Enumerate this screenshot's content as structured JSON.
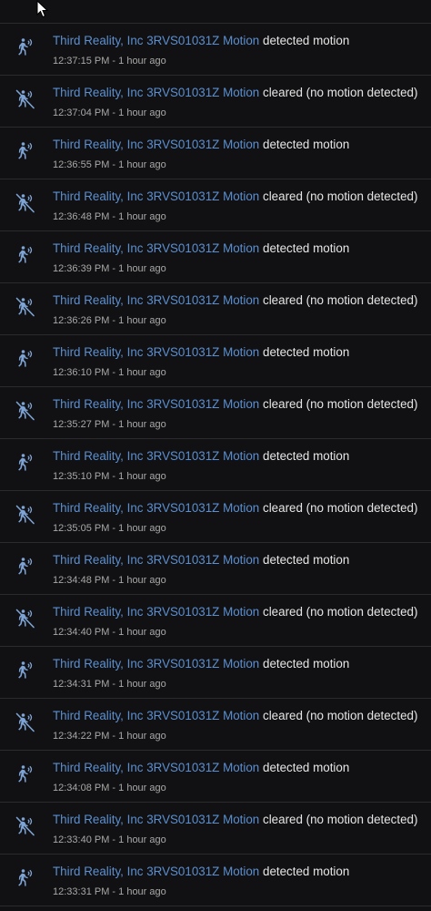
{
  "colors": {
    "background": "#111113",
    "divider": "#2b2b2d",
    "entity_link": "#5b8fd0",
    "icon": "#7ea4d6",
    "text": "#e6e6e6",
    "secondary_text": "#a8a8a8"
  },
  "entries": [
    {
      "entity": "Third Reality, Inc 3RVS01031Z Motion",
      "message": "detected motion",
      "time": "12:37:15 PM - 1 hour ago",
      "icon": "motion-sensor-icon"
    },
    {
      "entity": "Third Reality, Inc 3RVS01031Z Motion",
      "message": "cleared (no motion detected)",
      "time": "12:37:04 PM - 1 hour ago",
      "icon": "motion-sensor-off-icon"
    },
    {
      "entity": "Third Reality, Inc 3RVS01031Z Motion",
      "message": "detected motion",
      "time": "12:36:55 PM - 1 hour ago",
      "icon": "motion-sensor-icon"
    },
    {
      "entity": "Third Reality, Inc 3RVS01031Z Motion",
      "message": "cleared (no motion detected)",
      "time": "12:36:48 PM - 1 hour ago",
      "icon": "motion-sensor-off-icon"
    },
    {
      "entity": "Third Reality, Inc 3RVS01031Z Motion",
      "message": "detected motion",
      "time": "12:36:39 PM - 1 hour ago",
      "icon": "motion-sensor-icon"
    },
    {
      "entity": "Third Reality, Inc 3RVS01031Z Motion",
      "message": "cleared (no motion detected)",
      "time": "12:36:26 PM - 1 hour ago",
      "icon": "motion-sensor-off-icon"
    },
    {
      "entity": "Third Reality, Inc 3RVS01031Z Motion",
      "message": "detected motion",
      "time": "12:36:10 PM - 1 hour ago",
      "icon": "motion-sensor-icon"
    },
    {
      "entity": "Third Reality, Inc 3RVS01031Z Motion",
      "message": "cleared (no motion detected)",
      "time": "12:35:27 PM - 1 hour ago",
      "icon": "motion-sensor-off-icon"
    },
    {
      "entity": "Third Reality, Inc 3RVS01031Z Motion",
      "message": "detected motion",
      "time": "12:35:10 PM - 1 hour ago",
      "icon": "motion-sensor-icon"
    },
    {
      "entity": "Third Reality, Inc 3RVS01031Z Motion",
      "message": "cleared (no motion detected)",
      "time": "12:35:05 PM - 1 hour ago",
      "icon": "motion-sensor-off-icon"
    },
    {
      "entity": "Third Reality, Inc 3RVS01031Z Motion",
      "message": "detected motion",
      "time": "12:34:48 PM - 1 hour ago",
      "icon": "motion-sensor-icon"
    },
    {
      "entity": "Third Reality, Inc 3RVS01031Z Motion",
      "message": "cleared (no motion detected)",
      "time": "12:34:40 PM - 1 hour ago",
      "icon": "motion-sensor-off-icon"
    },
    {
      "entity": "Third Reality, Inc 3RVS01031Z Motion",
      "message": "detected motion",
      "time": "12:34:31 PM - 1 hour ago",
      "icon": "motion-sensor-icon"
    },
    {
      "entity": "Third Reality, Inc 3RVS01031Z Motion",
      "message": "cleared (no motion detected)",
      "time": "12:34:22 PM - 1 hour ago",
      "icon": "motion-sensor-off-icon"
    },
    {
      "entity": "Third Reality, Inc 3RVS01031Z Motion",
      "message": "detected motion",
      "time": "12:34:08 PM - 1 hour ago",
      "icon": "motion-sensor-icon"
    },
    {
      "entity": "Third Reality, Inc 3RVS01031Z Motion",
      "message": "cleared (no motion detected)",
      "time": "12:33:40 PM - 1 hour ago",
      "icon": "motion-sensor-off-icon"
    },
    {
      "entity": "Third Reality, Inc 3RVS01031Z Motion",
      "message": "detected motion",
      "time": "12:33:31 PM - 1 hour ago",
      "icon": "motion-sensor-icon"
    }
  ]
}
